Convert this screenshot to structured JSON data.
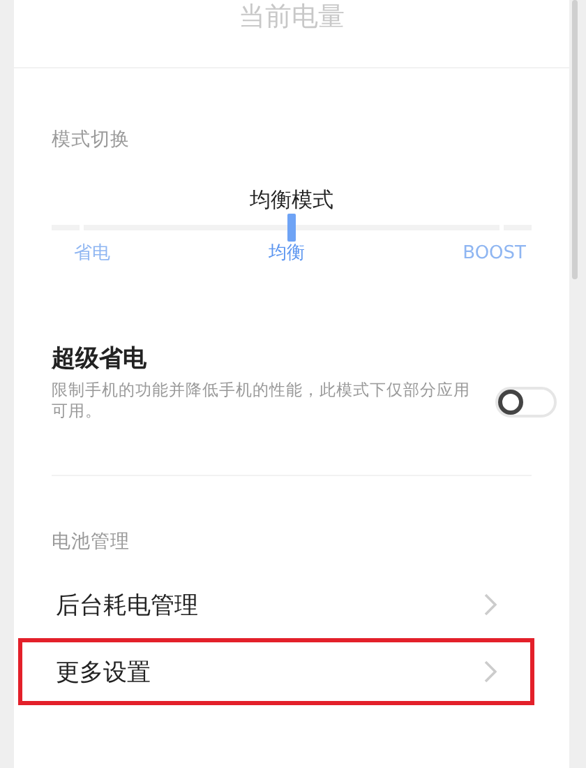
{
  "header": {
    "title": "当前电量"
  },
  "mode_section": {
    "heading": "模式切换",
    "current_mode": "均衡模式",
    "slider": {
      "level": 0.5
    },
    "stops": [
      {
        "label": "省电",
        "selected": false
      },
      {
        "label": "均衡",
        "selected": true
      },
      {
        "label": "BOOST",
        "selected": false
      }
    ]
  },
  "super_saver": {
    "title": "超级省电",
    "description": "限制手机的功能并降低手机的性能，此模式下仅部分应用可用。",
    "on": false
  },
  "battery_section": {
    "heading": "电池管理",
    "items": [
      {
        "label": "后台耗电管理",
        "highlighted": false
      },
      {
        "label": "更多设置",
        "highlighted": true
      }
    ]
  }
}
